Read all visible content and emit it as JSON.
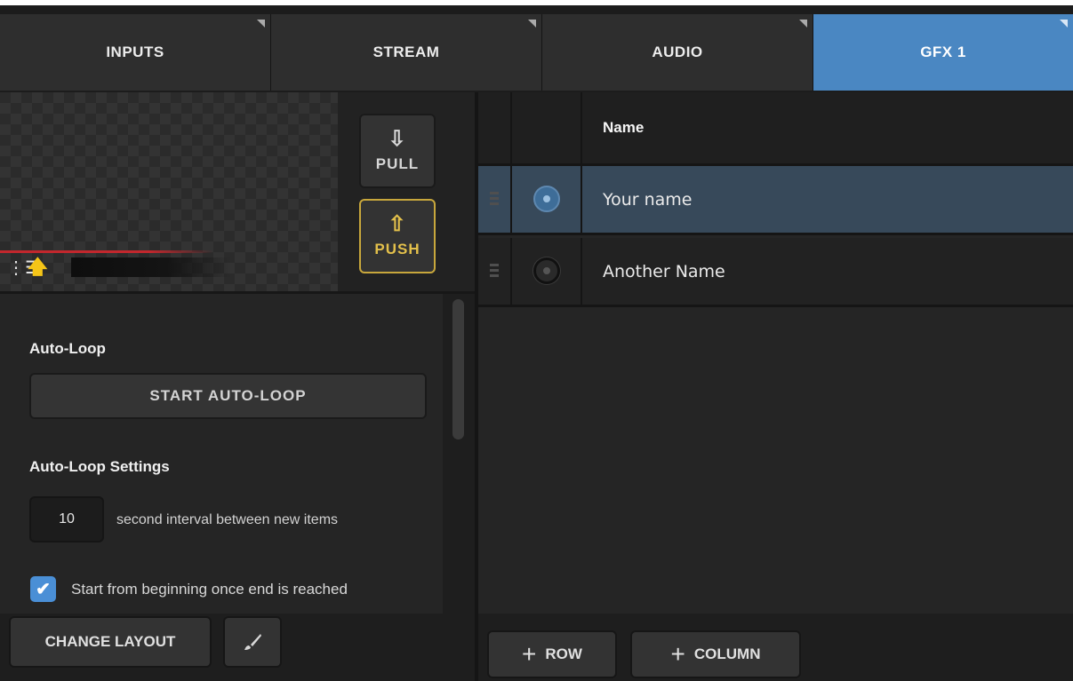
{
  "tabs": [
    {
      "label": "INPUTS",
      "active": false
    },
    {
      "label": "STREAM",
      "active": false
    },
    {
      "label": "AUDIO",
      "active": false
    },
    {
      "label": "GFX 1",
      "active": true
    }
  ],
  "preview": {
    "list_icon": "list-icon",
    "upload_icon": "up-arrow-icon",
    "pull": {
      "label": "PULL",
      "icon": "down-arrow-outline-icon",
      "glyph": "⇩"
    },
    "push": {
      "label": "PUSH",
      "icon": "up-arrow-outline-icon",
      "glyph": "⇧"
    }
  },
  "autoloop": {
    "title": "Auto-Loop",
    "button_label": "START AUTO-LOOP",
    "settings_title": "Auto-Loop Settings",
    "interval_value": "10",
    "interval_text": "second interval between new items",
    "restart_checked": true,
    "restart_label": "Start from beginning once end is reached"
  },
  "bottom_left": {
    "change_layout_label": "CHANGE LAYOUT",
    "brush_icon": "paintbrush-icon"
  },
  "table": {
    "columns": [
      "Name"
    ],
    "rows": [
      {
        "name": "Your name",
        "selected": true
      },
      {
        "name": "Another Name",
        "selected": false
      }
    ]
  },
  "bottom_right": {
    "add_row_label": "ROW",
    "add_column_label": "COLUMN",
    "plus_glyph": "+"
  },
  "colors": {
    "accent": "#4a87c2",
    "push_gold": "#c8a73c",
    "selected_row": "#37495a",
    "checkbox_blue": "#4a8fd6"
  }
}
